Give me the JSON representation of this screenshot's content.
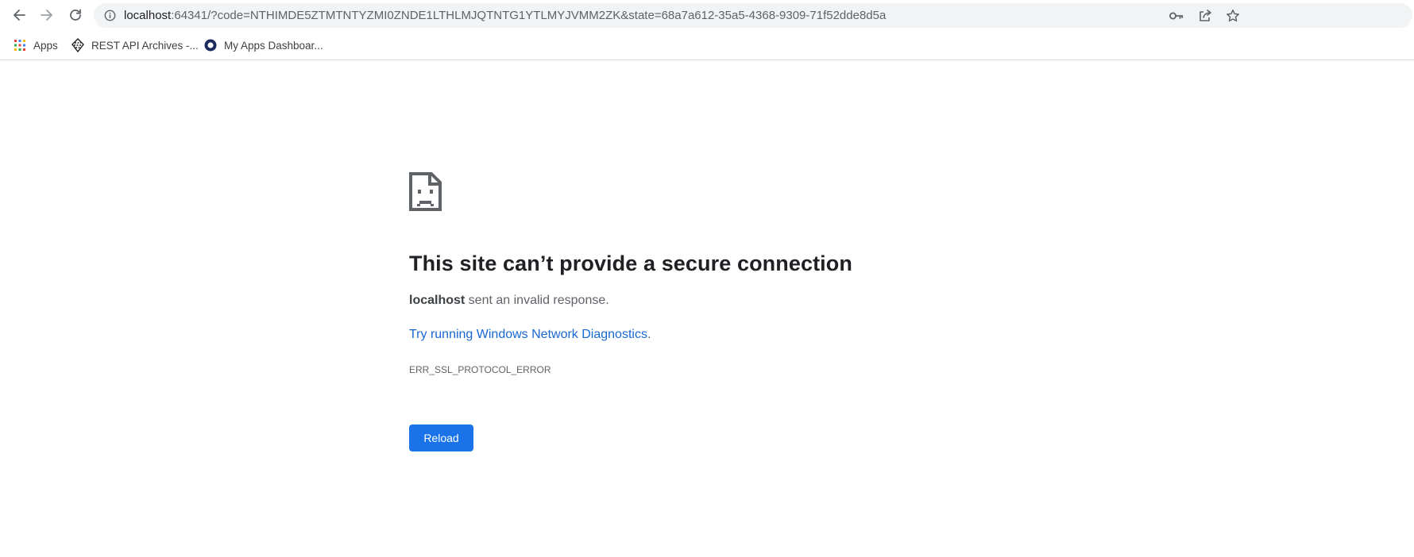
{
  "browser": {
    "omnibox": {
      "url_host": "localhost",
      "url_rest": ":64341/?code=NTHIMDE5ZTMTNTYZMI0ZNDE1LTHLMJQTNTG1YTLMYJVMM2ZK&state=68a7a612-35a5-4368-9309-71f52dde8d5a"
    },
    "bookmarks": [
      {
        "label": "Apps",
        "icon": "apps-grid-icon"
      },
      {
        "label": "REST API Archives -...",
        "icon": "rest-api-favicon"
      },
      {
        "label": "My Apps Dashboar...",
        "icon": "my-apps-favicon"
      }
    ]
  },
  "error_page": {
    "icon": "sad-page-icon",
    "headline": "This site can’t provide a secure connection",
    "summary_host": "localhost",
    "summary_text": " sent an invalid response.",
    "suggestion_link": "Try running Windows Network Diagnostics",
    "suggestion_suffix": ".",
    "error_code": "ERR_SSL_PROTOCOL_ERROR",
    "reload_label": "Reload"
  },
  "colors": {
    "accent": "#1a73e8",
    "link": "#1967d2",
    "omnibox_bg": "#f1f3f4"
  }
}
